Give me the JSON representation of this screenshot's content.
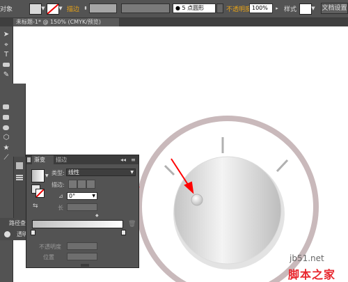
{
  "control_bar": {
    "object_label": "对象",
    "stroke_label": "描边",
    "stroke_label_color": "#e8a317",
    "brush_value": "● 5 点圆形",
    "opacity_label": "不透明度",
    "opacity_label_color": "#e8a317",
    "opacity_value": "100%",
    "style_label": "样式",
    "doc_setup_button": "文档设置"
  },
  "document": {
    "tab_title": "未标题-1* @ 150% (CMYK/预览)"
  },
  "tools": {
    "items": [
      "selection-arrow-icon",
      "direct-select-icon",
      "type-icon",
      "rectangle-icon",
      "pen-icon",
      "brush-icon"
    ]
  },
  "dock": {
    "pathfinder_label": "路径查找器",
    "transparency_label": "透明"
  },
  "gradient_panel": {
    "tab_gradient": "渐变",
    "tab_stroke": "描边",
    "type_label": "类型:",
    "type_value": "线性",
    "stroke_label": "描边:",
    "angle_value": "0°",
    "aspect_label": "长",
    "opacity_label": "不透明度",
    "position_label": "位置"
  },
  "artwork": {
    "accent_color": "#ff0000",
    "ring_color": "#c9b9bb"
  },
  "watermark": {
    "site": "jb51.net",
    "name": "脚本之家"
  }
}
